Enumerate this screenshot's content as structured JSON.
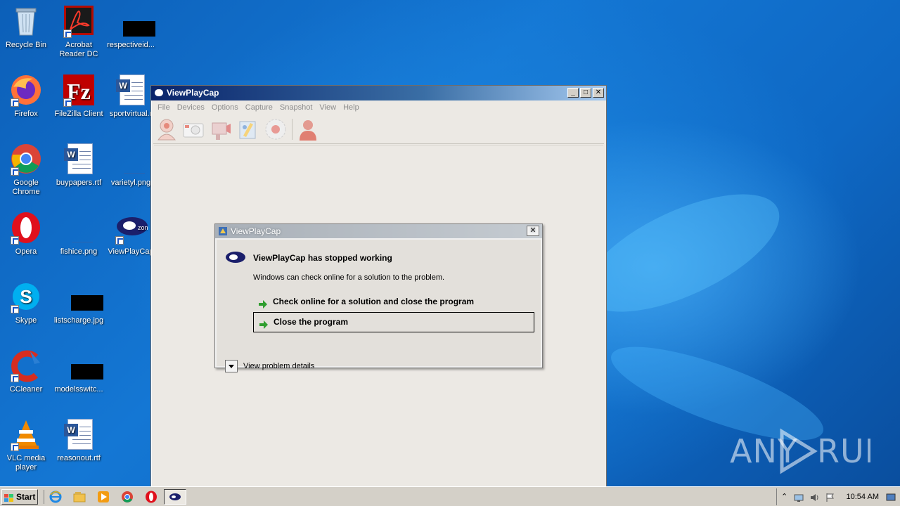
{
  "desktop": {
    "icons": [
      {
        "label": "Recycle Bin",
        "icon": "recycle-bin-icon"
      },
      {
        "label": "Acrobat Reader DC",
        "icon": "acrobat-icon"
      },
      {
        "label": "respectiveid...",
        "icon": "black-thumbnail-icon"
      },
      {
        "label": "Firefox",
        "icon": "firefox-icon"
      },
      {
        "label": "FileZilla Client",
        "icon": "filezilla-icon"
      },
      {
        "label": "sportvirtual.r",
        "icon": "word-document-icon"
      },
      {
        "label": "Google Chrome",
        "icon": "chrome-icon"
      },
      {
        "label": "buypapers.rtf",
        "icon": "word-document-icon"
      },
      {
        "label": "varietyl.png",
        "icon": "image-file-icon"
      },
      {
        "label": "Opera",
        "icon": "opera-icon"
      },
      {
        "label": "fishice.png",
        "icon": "image-file-icon"
      },
      {
        "label": "ViewPlayCap",
        "icon": "viewplaycap-icon"
      },
      {
        "label": "Skype",
        "icon": "skype-icon"
      },
      {
        "label": "listscharge.jpg",
        "icon": "black-thumbnail-icon"
      },
      {
        "label": "CCleaner",
        "icon": "ccleaner-icon"
      },
      {
        "label": "modelsswitc...",
        "icon": "black-thumbnail-icon"
      },
      {
        "label": "VLC media player",
        "icon": "vlc-icon"
      },
      {
        "label": "reasonout.rtf",
        "icon": "word-document-icon"
      }
    ]
  },
  "app_window": {
    "title": "ViewPlayCap",
    "menu": [
      "File",
      "Devices",
      "Options",
      "Capture",
      "Snapshot",
      "View",
      "Help"
    ],
    "toolbar_icons": [
      "webcam-icon",
      "camera-icon",
      "video-camera-icon",
      "paint-icon",
      "record-icon",
      "user-icon"
    ],
    "window_buttons": {
      "minimize": "_",
      "maximize": "□",
      "close": "✕"
    }
  },
  "dialog": {
    "title": "ViewPlayCap",
    "heading": "ViewPlayCap has stopped working",
    "description": "Windows can check online for a solution to the problem.",
    "command_check": "Check online for a solution and close the program",
    "command_close": "Close the program",
    "details": "View problem details",
    "close_glyph": "✕"
  },
  "taskbar": {
    "start_label": "Start",
    "clock": "10:54 AM",
    "tray_expand": "⌃",
    "pinned": [
      "ie-icon",
      "explorer-icon",
      "media-player-icon",
      "chrome-icon",
      "opera-icon"
    ],
    "active_task": "viewplaycap-task"
  },
  "watermark": {
    "text": "ANY RUN"
  },
  "colors": {
    "desktop_blue": "#0b62b8",
    "titlebar_dark": "#0a246a",
    "green_arrow": "#2f9e2f"
  }
}
